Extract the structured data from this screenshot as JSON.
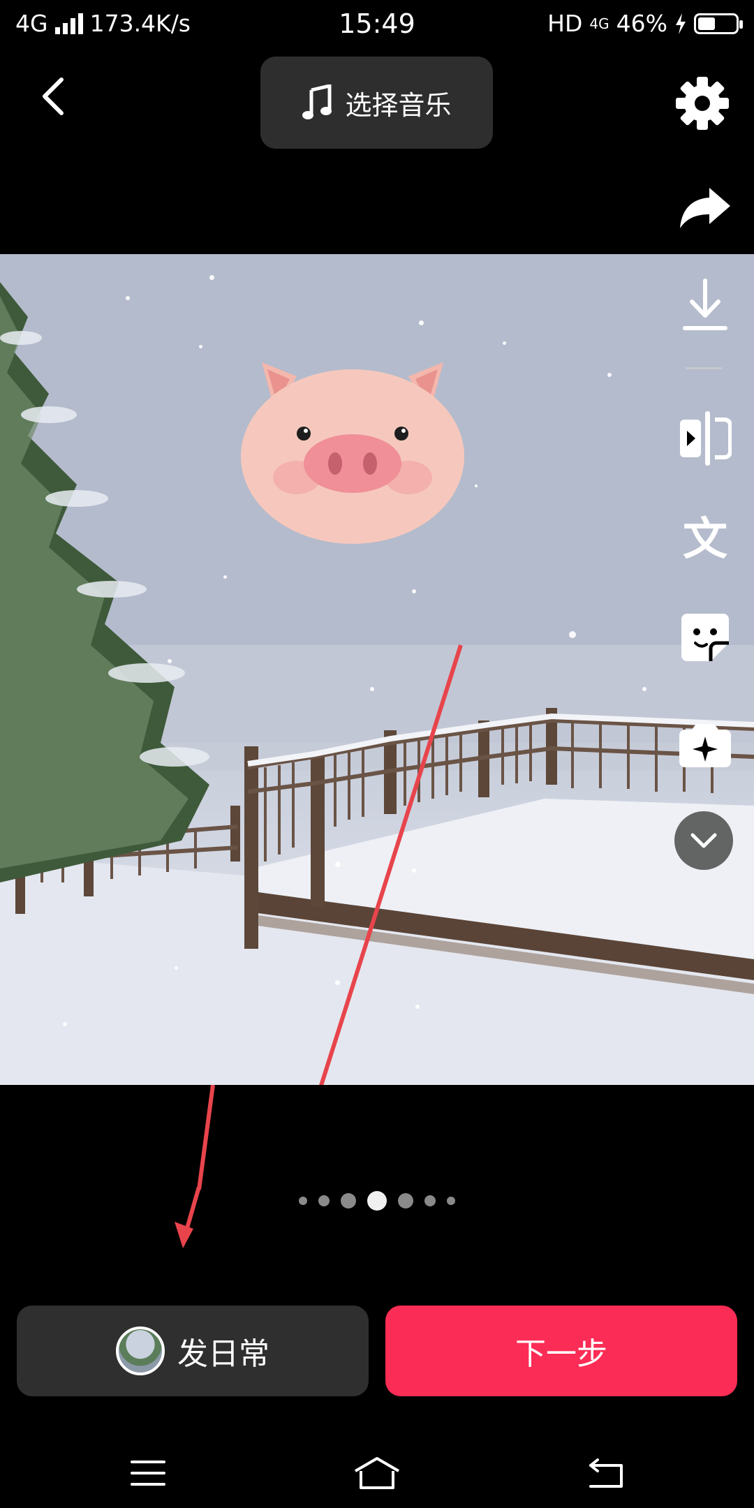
{
  "status_bar": {
    "network": "4G",
    "speed": "173.4K/s",
    "time": "15:49",
    "hd": "HD",
    "net2": "4G",
    "battery_percent": "46%",
    "battery_level": 0.46
  },
  "header": {
    "music_label": "选择音乐"
  },
  "pager": {
    "count": 7,
    "active_index": 3
  },
  "bottom": {
    "daily_label": "发日常",
    "next_label": "下一步",
    "next_color": "#fb2c55"
  },
  "icons": {
    "back": "back-arrow-icon",
    "music": "music-note-icon",
    "settings": "gear-icon",
    "share": "share-icon",
    "download": "download-icon",
    "split": "split-icon",
    "text": "text-icon",
    "text_glyph": "文",
    "sticker": "sticker-icon",
    "effect": "effect-icon",
    "expand": "chevron-down-icon",
    "nav_menu": "menu-icon",
    "nav_home": "home-icon",
    "nav_back": "back-icon"
  }
}
